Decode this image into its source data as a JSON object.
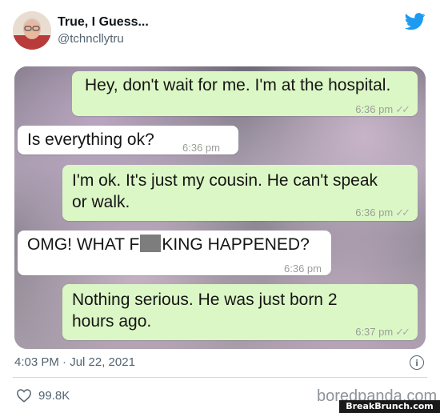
{
  "tweet": {
    "display_name": "True, I Guess...",
    "handle": "@tchncllytru",
    "timestamp": "4:03 PM · Jul 22, 2021",
    "likes": "99.8K",
    "brand_color": "#1d9bf0"
  },
  "chat": {
    "messages": [
      {
        "direction": "out",
        "text": "Hey, don't wait for me. I'm at the hospital.",
        "time": "6:36 pm",
        "ticks": "✓✓"
      },
      {
        "direction": "in",
        "text": "Is everything ok?",
        "time": "6:36 pm"
      },
      {
        "direction": "out",
        "line1": "I'm ok. It's just my cousin. He can't speak",
        "line2": "or walk.",
        "time": "6:36 pm",
        "ticks": "✓✓"
      },
      {
        "direction": "in",
        "text_before": "OMG! WHAT F",
        "text_after": "KING HAPPENED?",
        "time": "6:36 pm"
      },
      {
        "direction": "out",
        "line1": "Nothing serious. He was just born 2",
        "line2": "hours ago.",
        "time": "6:37 pm",
        "ticks": "✓✓"
      }
    ]
  },
  "watermark": {
    "site": "boredpanda.com",
    "site2": "BreakBrunch.com"
  }
}
